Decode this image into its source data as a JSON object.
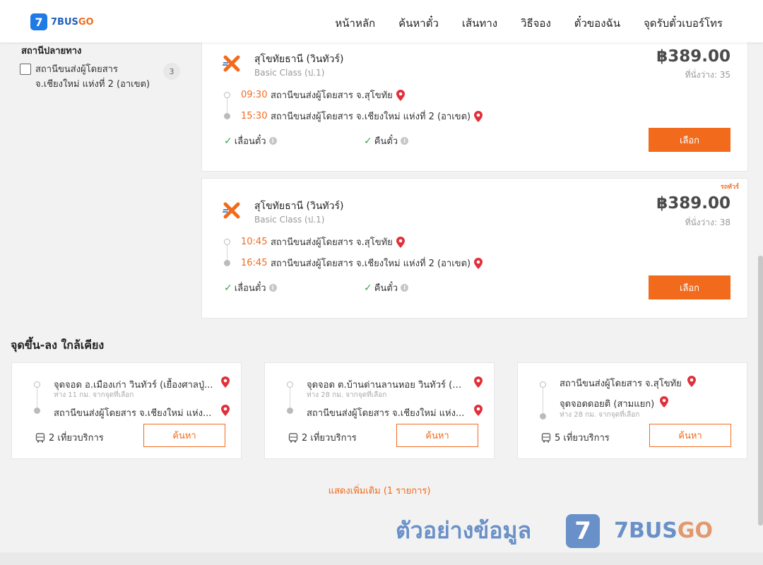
{
  "brand": {
    "name_prefix": "7BUS",
    "name_suffix": "GO",
    "mark": "7"
  },
  "nav": {
    "items": [
      "หน้าหลัก",
      "ค้นหาตั๋ว",
      "เส้นทาง",
      "วิธีจอง",
      "ตั๋วของฉัน",
      "จุดรับตั๋วเบอร์โทร"
    ]
  },
  "filter": {
    "title": "สถานีปลายทาง",
    "options": [
      {
        "label": "สถานีขนส่งผู้โดยสาร จ.เชียงใหม่ แห่งที่ 2 (อาเขต)",
        "count": "3",
        "checked": false
      }
    ]
  },
  "trips": [
    {
      "operator": "สุโขทัยธานี (วินทัวร์)",
      "class": "Basic Class (ป.1)",
      "price": "฿389.00",
      "seats": "ที่นั่งว่าง: 35",
      "tag": "",
      "depart_time": "09:30",
      "depart_place": "สถานีขนส่งผู้โดยสาร จ.สุโขทัย",
      "arrive_time": "15:30",
      "arrive_place": "สถานีขนส่งผู้โดยสาร จ.เชียงใหม่ แห่งที่ 2 (อาเขต)",
      "feature1": "เลื่อนตั๋ว",
      "feature2": "คืนตั๋ว",
      "select_label": "เลือก"
    },
    {
      "operator": "สุโขทัยธานี (วินทัวร์)",
      "class": "Basic Class (ป.1)",
      "price": "฿389.00",
      "seats": "ที่นั่งว่าง: 38",
      "tag": "รถทัวร์",
      "depart_time": "10:45",
      "depart_place": "สถานีขนส่งผู้โดยสาร จ.สุโขทัย",
      "arrive_time": "16:45",
      "arrive_place": "สถานีขนส่งผู้โดยสาร จ.เชียงใหม่ แห่งที่ 2 (อาเขต)",
      "feature1": "เลื่อนตั๋ว",
      "feature2": "คืนตั๋ว",
      "select_label": "เลือก"
    }
  ],
  "nearby": {
    "title": "จุดขึ้น-ลง ใกล้เคียง",
    "cards": [
      {
        "from": "จุดจอด อ.เมืองเก่า วินทัวร์ (เยื้องศาลปู่...",
        "from_dist": "ห่าง 11 กม. จากจุดที่เลือก",
        "to": "สถานีขนส่งผู้โดยสาร จ.เชียงใหม่ แห่ง...",
        "to_dist": "",
        "services": "2 เที่ยวบริการ",
        "search_label": "ค้นหา"
      },
      {
        "from": "จุดจอด ต.บ้านด่านลานหอย วินทัวร์ (ร้า...",
        "from_dist": "ห่าง 28 กม. จากจุดที่เลือก",
        "to": "สถานีขนส่งผู้โดยสาร จ.เชียงใหม่ แห่ง...",
        "to_dist": "",
        "services": "2 เที่ยวบริการ",
        "search_label": "ค้นหา"
      },
      {
        "from": "สถานีขนส่งผู้โดยสาร จ.สุโขทัย",
        "from_dist": "",
        "to": "จุดจอดดอยติ (สามแยก)",
        "to_dist": "ห่าง 28 กม. จากจุดที่เลือก",
        "services": "5 เที่ยวบริการ",
        "search_label": "ค้นหา"
      }
    ]
  },
  "show_more": "แสดงเพิ่มเติม (1 รายการ)",
  "watermark": {
    "text": "ตัวอย่างข้อมูล",
    "brand_prefix": "7BUS",
    "brand_suffix": "GO",
    "mark": "7"
  },
  "colors": {
    "accent": "#f26b1d",
    "brand_blue": "#1f7ae6",
    "pin_red": "#e0303a",
    "check_green": "#2ea84a"
  }
}
